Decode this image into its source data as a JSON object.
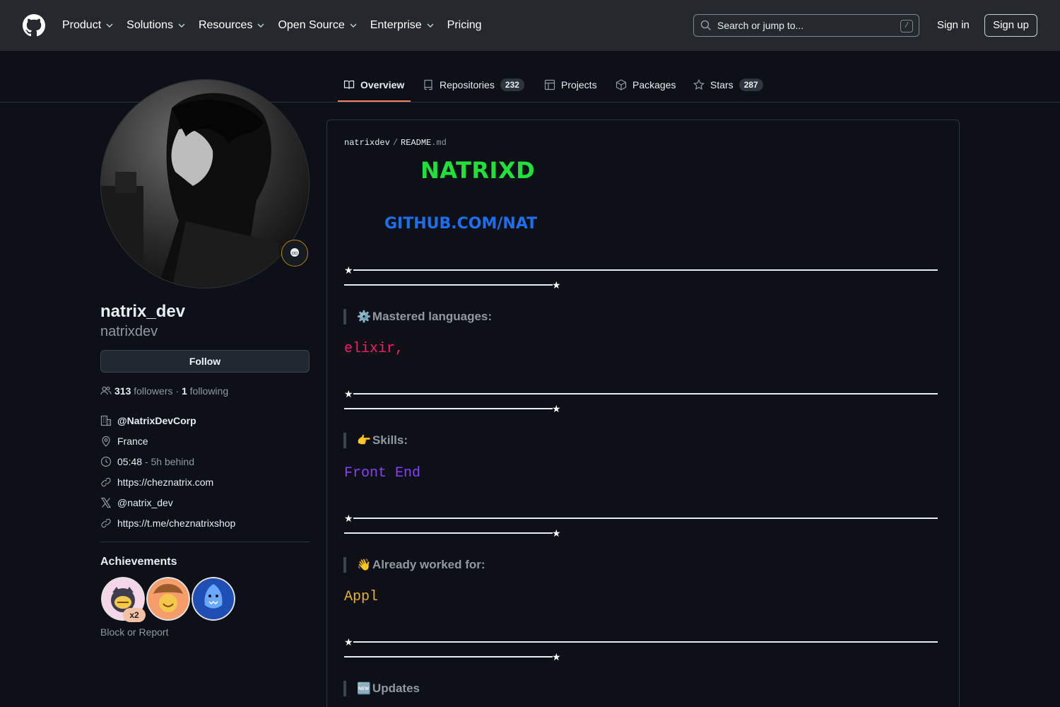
{
  "header": {
    "logo_icon": "github-mark-icon",
    "nav": [
      {
        "label": "Product",
        "has_menu": true
      },
      {
        "label": "Solutions",
        "has_menu": true
      },
      {
        "label": "Resources",
        "has_menu": true
      },
      {
        "label": "Open Source",
        "has_menu": true
      },
      {
        "label": "Enterprise",
        "has_menu": true
      },
      {
        "label": "Pricing",
        "has_menu": false
      }
    ],
    "search_placeholder": "Search or jump to...",
    "search_shortcut": "/",
    "signin_label": "Sign in",
    "signup_label": "Sign up"
  },
  "tabs": [
    {
      "label": "Overview",
      "icon": "book-icon",
      "active": true
    },
    {
      "label": "Repositories",
      "icon": "repo-icon",
      "count": "232"
    },
    {
      "label": "Projects",
      "icon": "table-icon"
    },
    {
      "label": "Packages",
      "icon": "package-icon"
    },
    {
      "label": "Stars",
      "icon": "star-icon",
      "count": "287"
    }
  ],
  "profile": {
    "display_name": "natrix_dev",
    "login": "natrixdev",
    "follow_label": "Follow",
    "followers_count": "313",
    "followers_label": "followers",
    "dot": "·",
    "following_count": "1",
    "following_label": "following",
    "org": "@NatrixDevCorp",
    "location": "France",
    "local_time": "05:48",
    "time_offset": "- 5h behind",
    "website": "https://cheznatrix.com",
    "x_handle": "@natrix_dev",
    "telegram": "https://t.me/cheznatrixshop",
    "achievements_title": "Achievements",
    "achievement_multiplier": "x2",
    "block_report": "Block or Report"
  },
  "readme": {
    "owner": "natrixdev",
    "separator": "/",
    "file_name": "README",
    "file_ext": ".md",
    "title": "NATRIXD",
    "subtitle": "GITHUB.COM/NAT",
    "sections": [
      {
        "emoji": "⚙️",
        "heading": "Mastered languages:",
        "code": "elixir,",
        "code_color": "#ff1a75"
      },
      {
        "emoji": "👉",
        "heading": "Skills:",
        "code": "Front End",
        "code_color": "#8a3ffc"
      },
      {
        "emoji": "👋",
        "heading": "Already worked for:",
        "code": "Appl",
        "code_color": "#e8b430"
      },
      {
        "emoji": "🆕",
        "heading": "Updates"
      }
    ],
    "colors": {
      "title": "#22e03a",
      "subtitle": "#1e6ff0"
    }
  },
  "colors": {
    "header_bg": "#25292e",
    "page_bg": "#0d1117",
    "tab_accent": "#f78166"
  }
}
